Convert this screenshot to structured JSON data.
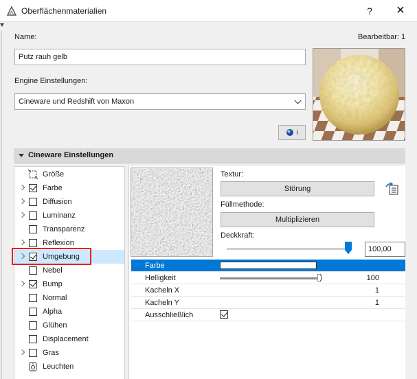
{
  "window": {
    "title": "Oberflächenmaterialien",
    "help_label": "?",
    "close_label": "✕"
  },
  "header": {
    "name_label": "Name:",
    "editable_label": "Bearbeitbar: 1",
    "name_value": "Putz rauh gelb",
    "engine_label": "Engine Einstellungen:",
    "engine_value": "Cineware und Redshift von Maxon",
    "info_button_label": "i"
  },
  "section": {
    "title": "Cineware Einstellungen"
  },
  "channels": [
    {
      "label": "Größe",
      "expandable": false,
      "control": "icon",
      "icon": "size-icon"
    },
    {
      "label": "Farbe",
      "expandable": true,
      "control": "checkbox",
      "checked": true
    },
    {
      "label": "Diffusion",
      "expandable": true,
      "control": "checkbox",
      "checked": false
    },
    {
      "label": "Luminanz",
      "expandable": true,
      "control": "checkbox",
      "checked": false
    },
    {
      "label": "Transparenz",
      "expandable": false,
      "control": "checkbox",
      "checked": false
    },
    {
      "label": "Reflexion",
      "expandable": true,
      "control": "checkbox",
      "checked": false
    },
    {
      "label": "Umgebung",
      "expandable": true,
      "control": "checkbox",
      "checked": true,
      "selected": true
    },
    {
      "label": "Nebel",
      "expandable": false,
      "control": "checkbox",
      "checked": false
    },
    {
      "label": "Bump",
      "expandable": true,
      "control": "checkbox",
      "checked": true
    },
    {
      "label": "Normal",
      "expandable": false,
      "control": "checkbox",
      "checked": false
    },
    {
      "label": "Alpha",
      "expandable": false,
      "control": "checkbox",
      "checked": false
    },
    {
      "label": "Glühen",
      "expandable": false,
      "control": "checkbox",
      "checked": false
    },
    {
      "label": "Displacement",
      "expandable": false,
      "control": "checkbox",
      "checked": false
    },
    {
      "label": "Gras",
      "expandable": true,
      "control": "checkbox",
      "checked": false
    },
    {
      "label": "Leuchten",
      "expandable": false,
      "control": "icon",
      "icon": "light-icon"
    }
  ],
  "texture": {
    "texture_label": "Textur:",
    "texture_button": "Störung",
    "fill_label": "Füllmethode:",
    "fill_button": "Multiplizieren",
    "opacity_label": "Deckkraft:",
    "opacity_value": "100,00",
    "opacity_fraction": 1.0
  },
  "properties": [
    {
      "name": "Farbe",
      "type": "color",
      "value": "",
      "selected": true
    },
    {
      "name": "Helligkeit",
      "type": "slider",
      "value": "100"
    },
    {
      "name": "Kacheln X",
      "type": "number",
      "value": "1"
    },
    {
      "name": "Kacheln Y",
      "type": "number",
      "value": "1"
    },
    {
      "name": "Ausschließlich",
      "type": "checkbox",
      "value": "",
      "checked": true
    }
  ],
  "colors": {
    "accent": "#0078d7",
    "selection_light": "#cde8ff",
    "highlight_outline": "#e8201e"
  }
}
